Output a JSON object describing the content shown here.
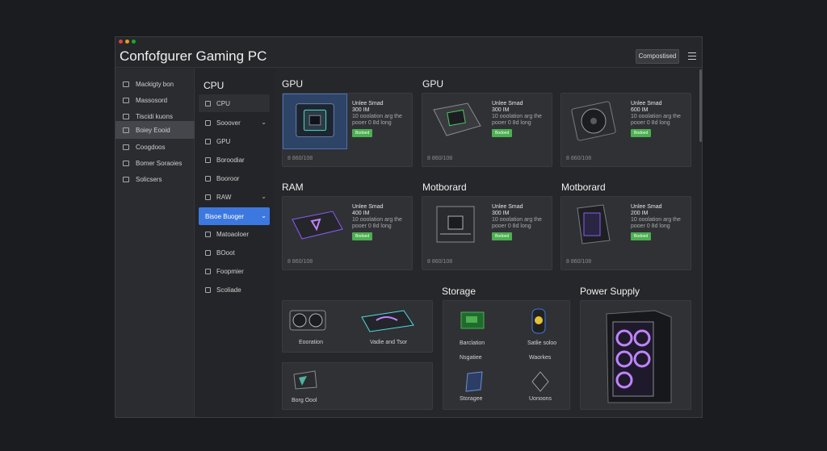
{
  "window": {
    "title": "Confofgurer Gaming PC",
    "toolbar_button": "Compostised",
    "menu_icon": "hamburger-menu-icon",
    "dots": [
      "#e0443e",
      "#dea123",
      "#1aab29"
    ]
  },
  "sidebar": {
    "items": [
      {
        "label": "Mackigty bon",
        "icon": "monitor-icon"
      },
      {
        "label": "Massosord",
        "icon": "list-icon"
      },
      {
        "label": "Tiscidi kuons",
        "icon": "chip-icon"
      },
      {
        "label": "Boiey Eooid",
        "icon": "folder-icon",
        "active": true
      },
      {
        "label": "Coogdoos",
        "icon": "grid-icon"
      },
      {
        "label": "Bomer Soraoies",
        "icon": "briefcase-icon"
      },
      {
        "label": "Solicsers",
        "icon": "gear-icon"
      }
    ]
  },
  "subnav": {
    "title": "CPU",
    "items": [
      {
        "label": "CPU",
        "selected": true
      },
      {
        "label": "Sooover",
        "chevron": true
      },
      {
        "label": "GPU"
      },
      {
        "label": "Boroodiar"
      },
      {
        "label": "Booroor"
      },
      {
        "label": "RAW",
        "chevron": true
      },
      {
        "label": "Bisoe Buoger",
        "chevron": true,
        "highlight": true
      },
      {
        "label": "Matoaoloer"
      },
      {
        "label": "BOoot"
      },
      {
        "label": "Foopmier"
      },
      {
        "label": "Scoliade"
      }
    ]
  },
  "sections": {
    "gpu1": "GPU",
    "gpu2": "GPU",
    "ram": "RAM",
    "mb1": "Motborard",
    "mb2": "Motborard",
    "storage": "Storage",
    "psu": "Power Supply"
  },
  "cards": [
    {
      "l1": "Unlee Smad",
      "l2": "300 IM",
      "l3": "10 ooolation arg the",
      "l4": "pooer 0 8d long",
      "badge": "Bodoed",
      "foot": "8 860/108",
      "thumb": "gpu-chip-icon",
      "hl": true
    },
    {
      "l1": "Unlee Smad",
      "l2": "300 IM",
      "l3": "10 ooolation arg the",
      "l4": "pooer 0 8d long",
      "badge": "Bodoed",
      "foot": "8 860/108",
      "thumb": "gpu-chip-icon"
    },
    {
      "l1": "Unlee Smad",
      "l2": "600 IM",
      "l3": "10 ooolation arg the",
      "l4": "pooer 0 8d long",
      "badge": "Bodoed",
      "foot": "8 860/108",
      "thumb": "cooler-fan-icon"
    },
    {
      "l1": "Unlee Smad",
      "l2": "400 IM",
      "l3": "10 ooolation arg the",
      "l4": "pooer 0 8d long",
      "badge": "Bodoed",
      "foot": "8 860/108",
      "thumb": "ram-module-icon"
    },
    {
      "l1": "Unlee Smad",
      "l2": "300 IM",
      "l3": "10 ooolation arg the",
      "l4": "pooer 0 8d long",
      "badge": "Bodoed",
      "foot": "8 860/108",
      "thumb": "motherboard-icon"
    },
    {
      "l1": "Unlee Smad",
      "l2": "200 IM",
      "l3": "10 ooolation arg the",
      "l4": "pooer 0 8d long",
      "badge": "Bodoed",
      "foot": "8 860/108",
      "thumb": "pc-case-icon"
    }
  ],
  "bottom": {
    "left": [
      "Eooration",
      "Vadie and Tsor",
      "Borg Oool"
    ],
    "storage": [
      "Barclation",
      "Satlie soloo",
      "Nsgatiee",
      "Waorkes",
      "Storagee",
      "Uonoons"
    ]
  }
}
